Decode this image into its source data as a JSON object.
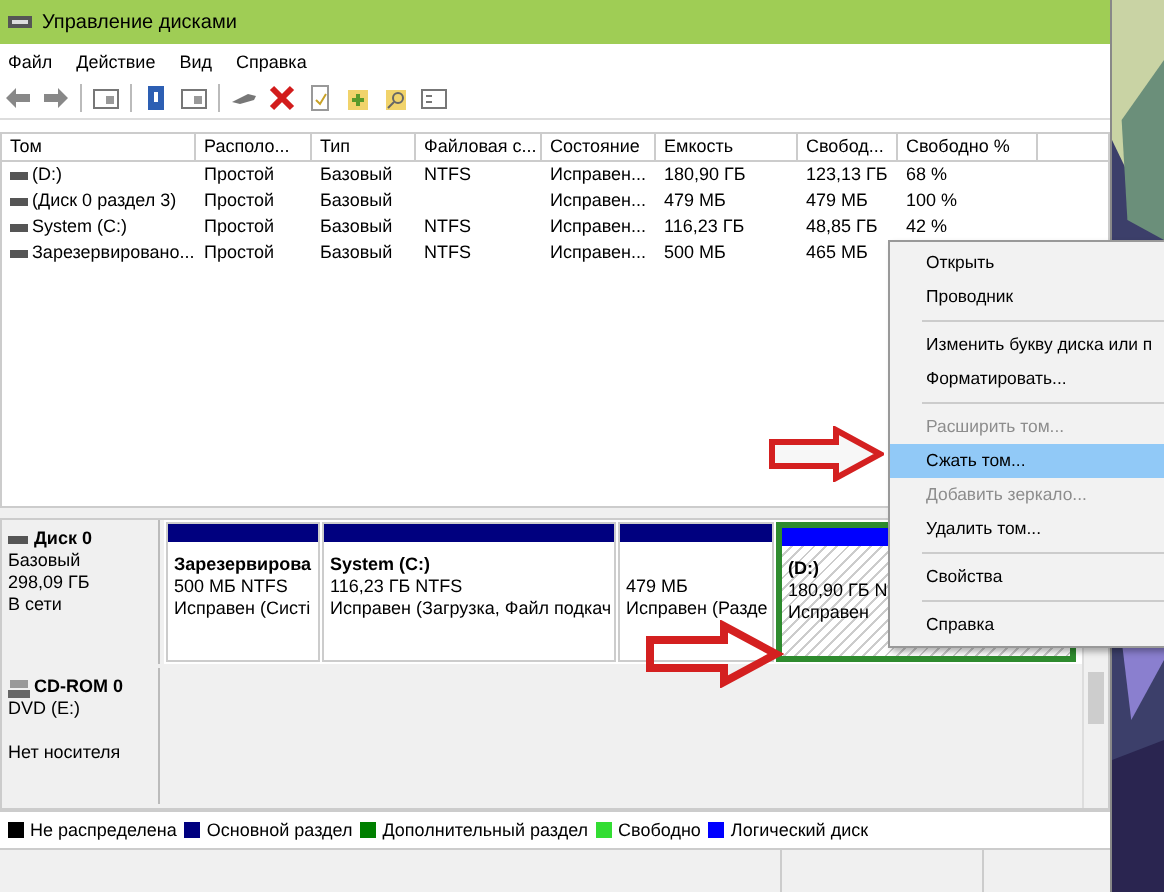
{
  "window": {
    "title": "Управление дисками"
  },
  "menu": [
    "Файл",
    "Действие",
    "Вид",
    "Справка"
  ],
  "table": {
    "columns": [
      "Том",
      "Располо...",
      "Тип",
      "Файловая с...",
      "Состояние",
      "Емкость",
      "Свобод...",
      "Свободно %"
    ],
    "rows": [
      {
        "cells": [
          "(D:)",
          "Простой",
          "Базовый",
          "NTFS",
          "Исправен...",
          "180,90 ГБ",
          "123,13 ГБ",
          "68 %"
        ]
      },
      {
        "cells": [
          "(Диск 0 раздел 3)",
          "Простой",
          "Базовый",
          "",
          "Исправен...",
          "479 МБ",
          "479 МБ",
          "100 %"
        ]
      },
      {
        "cells": [
          "System (C:)",
          "Простой",
          "Базовый",
          "NTFS",
          "Исправен...",
          "116,23 ГБ",
          "48,85 ГБ",
          "42 %"
        ]
      },
      {
        "cells": [
          "Зарезервировано...",
          "Простой",
          "Базовый",
          "NTFS",
          "Исправен...",
          "500 МБ",
          "465 МБ",
          ""
        ]
      }
    ]
  },
  "disks": [
    {
      "kind": "hdd",
      "name": "Диск 0",
      "lines": [
        "Базовый",
        "298,09 ГБ"
      ],
      "status": "В сети",
      "partitions": [
        {
          "kind": "primary",
          "selected": false,
          "title": "Зарезервирова",
          "lines": [
            "500 МБ NTFS",
            "Исправен (Систі"
          ]
        },
        {
          "kind": "primary",
          "selected": false,
          "title": "System  (C:)",
          "lines": [
            "116,23 ГБ NTFS",
            "Исправен (Загрузка, Файл подкач"
          ]
        },
        {
          "kind": "primary",
          "selected": false,
          "lines": [
            "479 МБ",
            "Исправен (Разде"
          ]
        },
        {
          "kind": "logical",
          "selected": true,
          "title": "(D:)",
          "lines": [
            "180,90 ГБ N",
            "Исправен"
          ]
        }
      ]
    },
    {
      "kind": "cdrom",
      "name": "CD-ROM 0",
      "lines": [
        "DVD (E:)"
      ],
      "status": "Нет носителя"
    }
  ],
  "legend": [
    {
      "label": "Не распределена",
      "color": "#000000"
    },
    {
      "label": "Основной раздел",
      "color": "#00007f"
    },
    {
      "label": "Дополнительный раздел",
      "color": "#007f00"
    },
    {
      "label": "Свободно",
      "color": "#33dd33"
    },
    {
      "label": "Логический диск",
      "color": "#0000ff"
    }
  ],
  "context_menu": [
    {
      "kind": "item",
      "label": "Открыть",
      "disabled": false,
      "selected": false
    },
    {
      "kind": "item",
      "label": "Проводник",
      "disabled": false,
      "selected": false
    },
    {
      "kind": "separator"
    },
    {
      "kind": "item",
      "label": "Изменить букву диска или п",
      "disabled": false,
      "selected": false
    },
    {
      "kind": "item",
      "label": "Форматировать...",
      "disabled": false,
      "selected": false
    },
    {
      "kind": "separator"
    },
    {
      "kind": "item",
      "label": "Расширить том...",
      "disabled": true,
      "selected": false
    },
    {
      "kind": "item",
      "label": "Сжать том...",
      "disabled": false,
      "selected": true
    },
    {
      "kind": "item",
      "label": "Добавить зеркало...",
      "disabled": true,
      "selected": false
    },
    {
      "kind": "item",
      "label": "Удалить том...",
      "disabled": false,
      "selected": false
    },
    {
      "kind": "separator"
    },
    {
      "kind": "item",
      "label": "Свойства",
      "disabled": false,
      "selected": false
    },
    {
      "kind": "separator"
    },
    {
      "kind": "item",
      "label": "Справка",
      "disabled": false,
      "selected": false
    }
  ]
}
